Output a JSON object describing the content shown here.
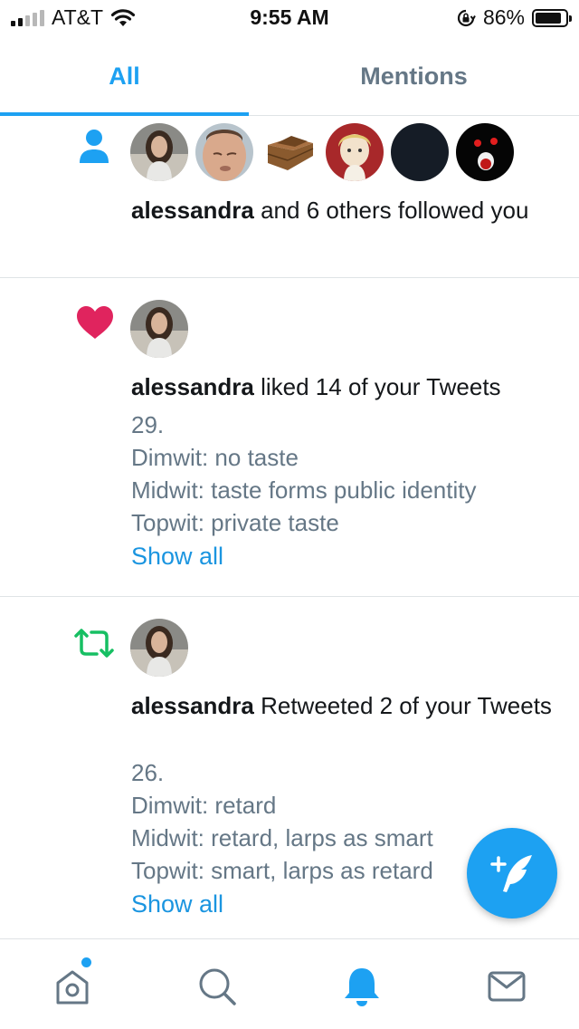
{
  "status_bar": {
    "carrier": "AT&T",
    "time": "9:55 AM",
    "battery_percent": "86%",
    "battery_level": 0.86,
    "signal_bars_active": 2
  },
  "tabs": [
    {
      "label": "All",
      "active": true
    },
    {
      "label": "Mentions",
      "active": false
    }
  ],
  "notifications": [
    {
      "type": "follow",
      "icon": "person-icon",
      "avatar_count": 7,
      "actor": "alessandra",
      "action": " and 6 others followed you"
    },
    {
      "type": "like",
      "icon": "heart-icon",
      "actor": "alessandra",
      "action": " liked 14 of your Tweets",
      "preview_lines": [
        "29.",
        "Dimwit: no taste",
        "Midwit: taste forms public identity",
        "Topwit: private taste"
      ],
      "show_all": "Show all"
    },
    {
      "type": "retweet",
      "icon": "retweet-icon",
      "actor": "alessandra",
      "action": " Retweeted 2 of your Tweets",
      "preview_lines": [
        "26.",
        "Dimwit: retard",
        "Midwit: retard, larps as smart",
        "Topwit: smart, larps as retard"
      ],
      "show_all": "Show all"
    }
  ],
  "fab": {
    "icon": "compose-tweet-icon"
  },
  "bottom_nav": [
    {
      "icon": "home-icon",
      "has_badge": true
    },
    {
      "icon": "search-icon",
      "active": false
    },
    {
      "icon": "notifications-bell-icon",
      "active": true
    },
    {
      "icon": "messages-envelope-icon",
      "active": false
    }
  ],
  "colors": {
    "accent": "#1da1f2",
    "like": "#e0245e",
    "retweet": "#17bf63",
    "secondary_text": "#657786",
    "divider": "#dfe3e6"
  }
}
